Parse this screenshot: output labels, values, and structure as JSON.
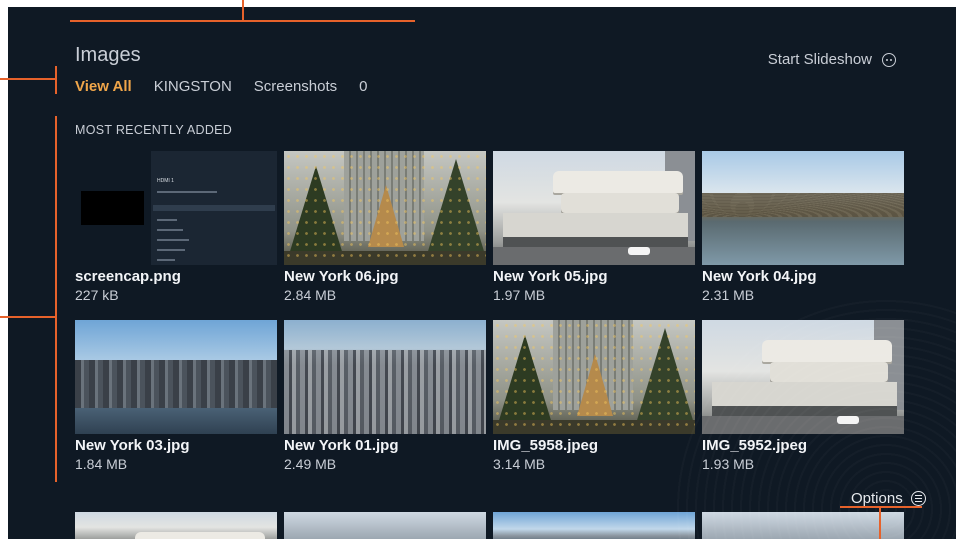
{
  "header": {
    "title": "Images",
    "slideshow_label": "Start Slideshow"
  },
  "tabs": [
    {
      "label": "View All",
      "active": true
    },
    {
      "label": "KINGSTON",
      "active": false
    },
    {
      "label": "Screenshots",
      "active": false
    },
    {
      "label": "0",
      "active": false
    }
  ],
  "section": {
    "label": "MOST RECENTLY ADDED"
  },
  "grid": {
    "items": [
      {
        "name": "screencap.png",
        "size": "227 kB"
      },
      {
        "name": "New York 06.jpg",
        "size": "2.84 MB"
      },
      {
        "name": "New York 05.jpg",
        "size": "1.97 MB"
      },
      {
        "name": "New York 04.jpg",
        "size": "2.31 MB"
      },
      {
        "name": "New York 03.jpg",
        "size": "1.84 MB"
      },
      {
        "name": "New York 01.jpg",
        "size": "2.49 MB"
      },
      {
        "name": "IMG_5958.jpeg",
        "size": "3.14 MB"
      },
      {
        "name": "IMG_5952.jpeg",
        "size": "1.93 MB"
      }
    ]
  },
  "screencap_preview": {
    "title": "HDMI 1"
  },
  "footer": {
    "options_label": "Options"
  },
  "colors": {
    "background": "#0f1924",
    "accent_tab": "#f0a64a",
    "callout": "#e6622b",
    "text_primary": "#f2f4f7",
    "text_secondary": "#c9ced6"
  }
}
